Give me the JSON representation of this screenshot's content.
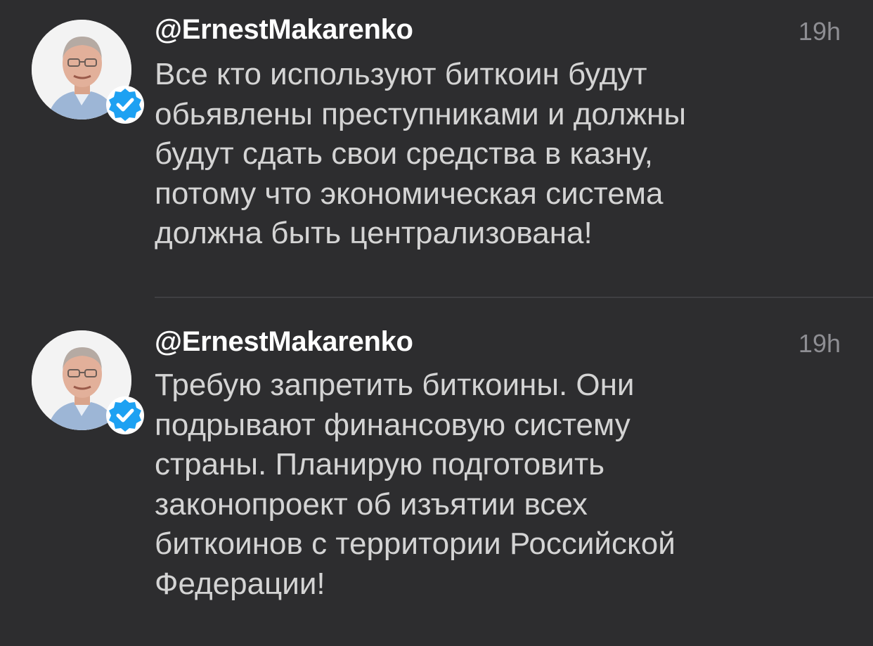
{
  "tweets": [
    {
      "handle": "@ErnestMakarenko",
      "time": "19h",
      "text": "Все кто используют биткоин будут\nобьявлены преступниками и должны\nбудут сдать свои средства в казну,\nпотому что экономическая система\nдолжна быть централизована!",
      "avatar_icon": "profile-photo-avatar",
      "badge_icon": "verified-badge-icon"
    },
    {
      "handle": "@ErnestMakarenko",
      "time": "19h",
      "text": "Требую запретить биткоины. Они\nподрывают финансовую систему\nстраны. Планирую подготовить\nзаконопроект об изъятии всех\nбиткоинов с территории Российской\nФедерации!",
      "avatar_icon": "profile-photo-avatar",
      "badge_icon": "verified-badge-icon"
    }
  ],
  "colors": {
    "background": "#2d2d2f",
    "handle": "#ffffff",
    "text": "#d4d4d4",
    "time": "#8e8e93",
    "verified": "#1da1f2"
  }
}
